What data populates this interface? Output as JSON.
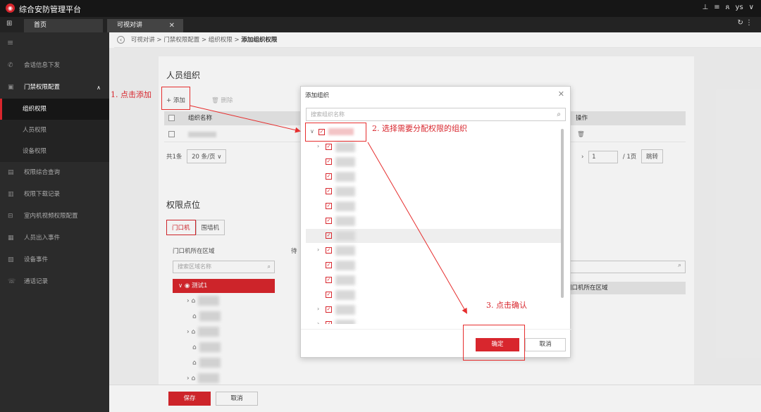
{
  "app": {
    "title": "综合安防管理平台",
    "user": "ys"
  },
  "tabs": {
    "home": "首页",
    "active": "可视对讲"
  },
  "sidebar": {
    "items": [
      {
        "label": "会话信息下发",
        "icon": "phone-icon"
      },
      {
        "label": "门禁权限配置",
        "icon": "door-icon"
      },
      {
        "label": "权限综合查询",
        "icon": "search-doc-icon"
      },
      {
        "label": "权限下载记录",
        "icon": "download-icon"
      },
      {
        "label": "室内机视频权限配置",
        "icon": "video-icon"
      },
      {
        "label": "人员出入事件",
        "icon": "person-icon"
      },
      {
        "label": "设备事件",
        "icon": "device-icon"
      },
      {
        "label": "通话记录",
        "icon": "call-icon"
      }
    ],
    "subitems": [
      "组织权限",
      "人员权限",
      "设备权限"
    ]
  },
  "breadcrumb": {
    "parts": [
      "可视对讲",
      "门禁权限配置",
      "组织权限"
    ],
    "current": "添加组织权限"
  },
  "section1": {
    "title": "人员组织",
    "add_label": "+ 添加",
    "delete_label": "删除",
    "col_name": "组织名称",
    "col_ops": "操作",
    "pager_total": "共1条",
    "pager_size": "20 条/页",
    "page_input": "1",
    "page_total": "/ 1页",
    "jump": "跳转"
  },
  "section2": {
    "title": "权限点位",
    "tab_door": "门口机",
    "tab_wall": "围墙机",
    "area_label": "门口机所在区域",
    "area_search_placeholder": "搜索区域名称",
    "area_root": "测试1",
    "wait_label": "待",
    "right_col": "门口机所在区域"
  },
  "footer": {
    "save": "保存",
    "cancel": "取消"
  },
  "dialog": {
    "title": "添加组织",
    "search_placeholder": "搜索组织名称",
    "confirm": "确定",
    "cancel": "取消"
  },
  "annotations": {
    "step1": "1. 点击添加",
    "step2": "2. 选择需要分配权限的组织",
    "step3": "3. 点击确认"
  },
  "colors": {
    "accent": "#d8262d",
    "annotation": "#e62e2e"
  }
}
